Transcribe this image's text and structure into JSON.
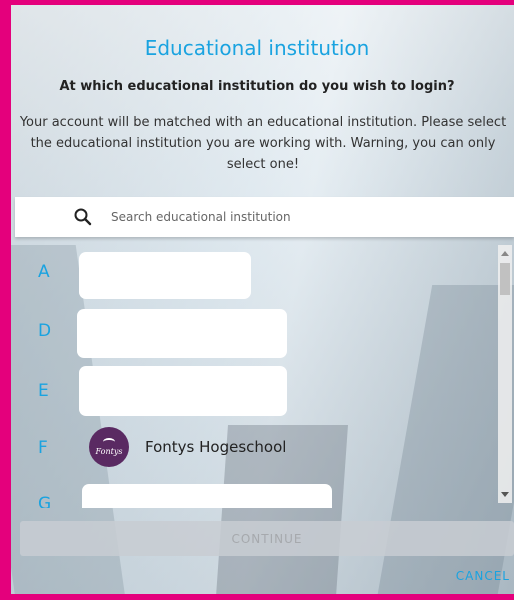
{
  "dialog": {
    "title": "Educational institution",
    "subtitle": "At which educational institution do you wish to login?",
    "description": "Your account will be matched with an educational institution. Please select the educational institution you are working with. Warning, you can only select one!"
  },
  "search": {
    "placeholder": "Search educational institution",
    "value": "",
    "icon": "search-icon"
  },
  "list": {
    "groups": [
      {
        "letter": "A",
        "items": [
          {
            "name": "",
            "redacted": true
          }
        ]
      },
      {
        "letter": "D",
        "items": [
          {
            "name": "",
            "redacted": true
          }
        ]
      },
      {
        "letter": "E",
        "items": [
          {
            "name": "",
            "redacted": true
          }
        ]
      },
      {
        "letter": "F",
        "items": [
          {
            "name": "Fontys Hogeschool",
            "logo_text": "Fontys",
            "logo_color": "#5a2a62"
          }
        ]
      },
      {
        "letter": "G",
        "items": [
          {
            "name": "",
            "redacted": true
          }
        ]
      }
    ]
  },
  "actions": {
    "continue_label": "CONTINUE",
    "cancel_label": "CANCEL"
  },
  "colors": {
    "accent": "#1aa3e0",
    "frame": "#e4007c"
  }
}
